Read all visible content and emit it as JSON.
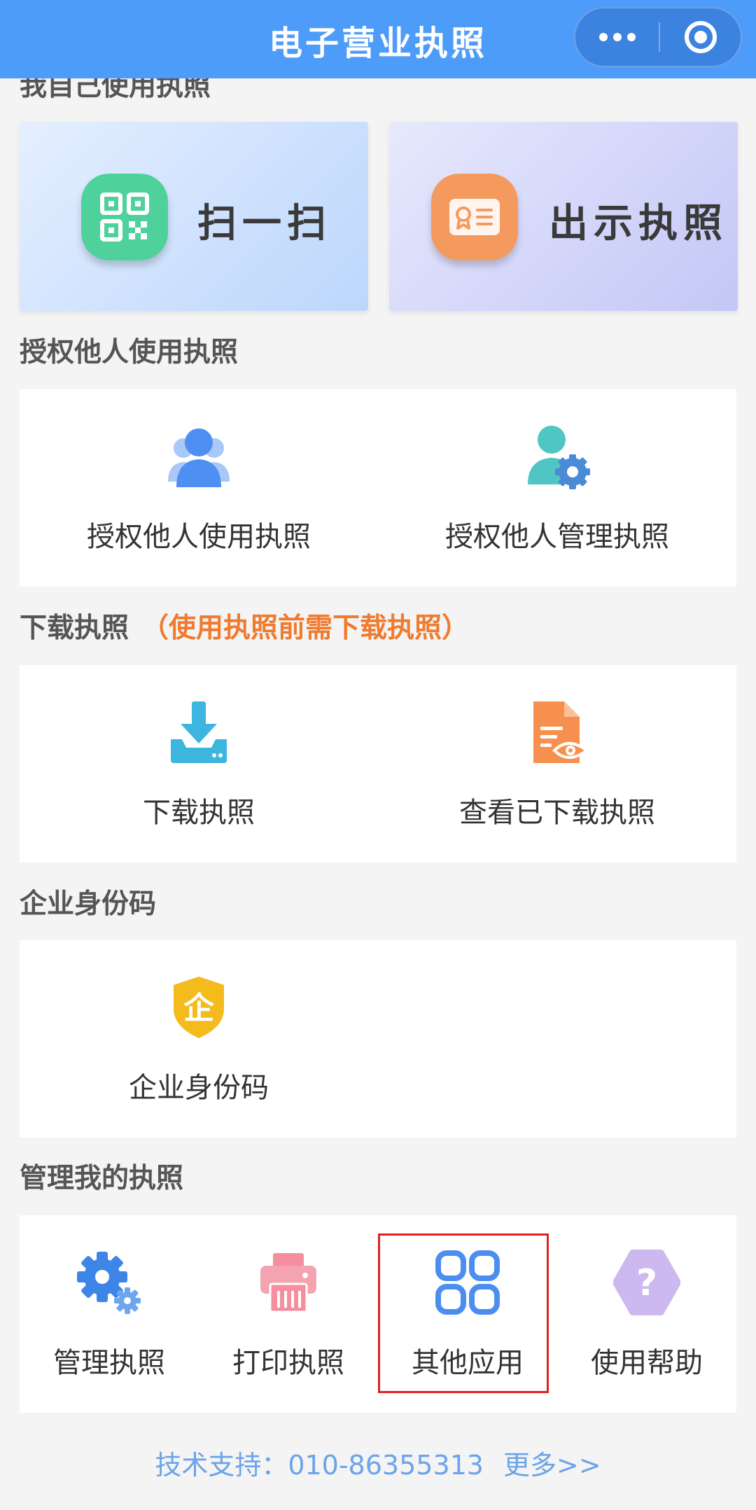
{
  "header": {
    "title": "电子营业执照",
    "more_icon": "more-dots-icon",
    "close_icon": "circle-target-icon",
    "color": "#4e9cf9"
  },
  "sections": {
    "own": {
      "title": "我自己使用执照"
    },
    "authorize": {
      "title": "授权他人使用执照"
    },
    "download": {
      "title": "下载执照",
      "note": "（使用执照前需下载执照）"
    },
    "identity": {
      "title": "企业身份码"
    },
    "manage": {
      "title": "管理我的执照"
    }
  },
  "features": {
    "scan": {
      "label": "扫一扫",
      "icon": "qr-code-icon",
      "color": "#4fd19b"
    },
    "show": {
      "label": "出示执照",
      "icon": "license-card-icon",
      "color": "#f59a5e"
    }
  },
  "authorize_items": [
    {
      "label": "授权他人使用执照",
      "icon": "users-icon"
    },
    {
      "label": "授权他人管理执照",
      "icon": "user-gear-icon"
    }
  ],
  "download_items": [
    {
      "label": "下载执照",
      "icon": "download-tray-icon"
    },
    {
      "label": "查看已下载执照",
      "icon": "document-eye-icon"
    }
  ],
  "identity_items": [
    {
      "label": "企业身份码",
      "icon": "enterprise-shield-icon",
      "glyph": "企"
    }
  ],
  "manage_items": [
    {
      "label": "管理执照",
      "icon": "gears-icon"
    },
    {
      "label": "打印执照",
      "icon": "printer-icon"
    },
    {
      "label": "其他应用",
      "icon": "apps-grid-icon"
    },
    {
      "label": "使用帮助",
      "icon": "help-question-icon",
      "glyph": "?"
    }
  ],
  "footer": {
    "support": "技术支持：010-86355313",
    "more": "更多>>"
  }
}
